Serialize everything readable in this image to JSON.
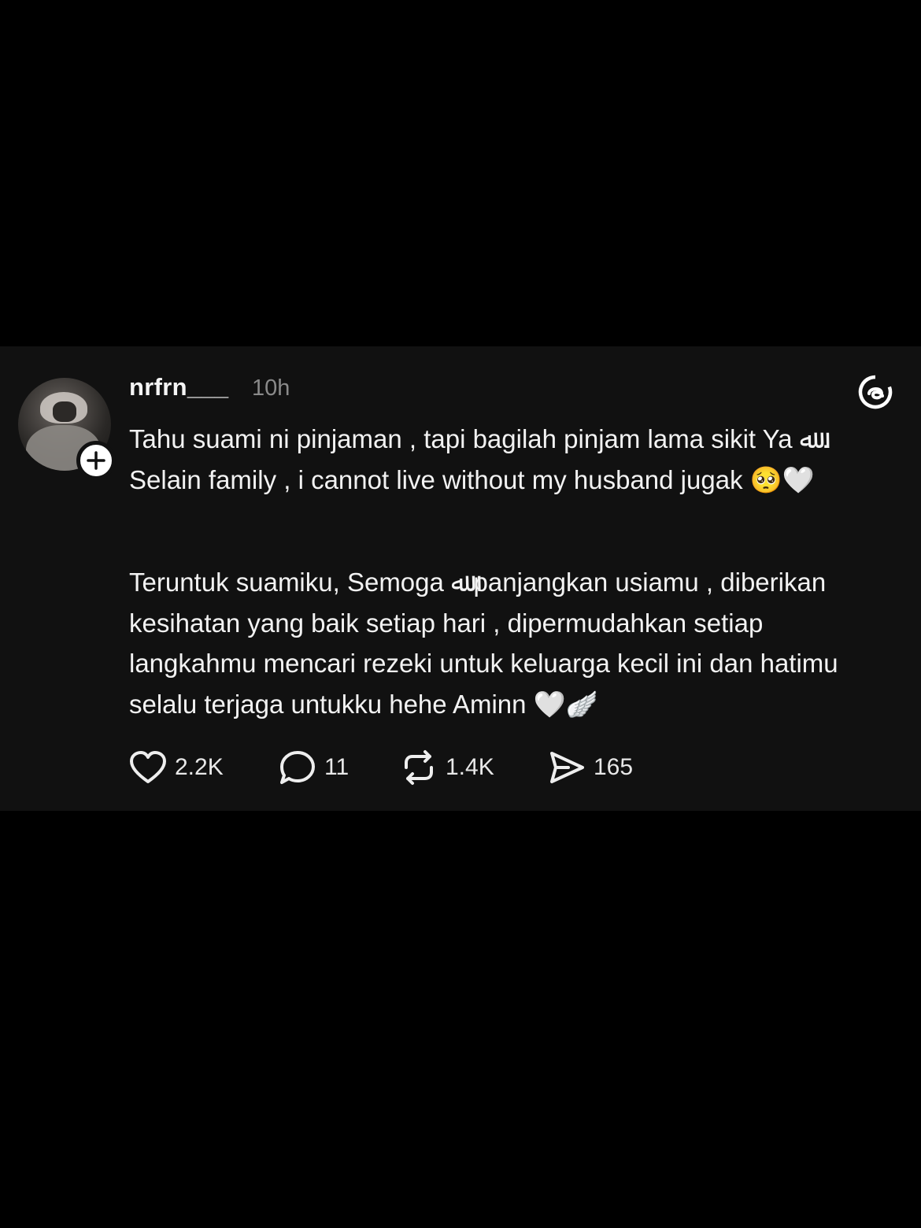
{
  "post": {
    "username": "nrfrn___",
    "timestamp": "10h",
    "paragraphs": [
      "Tahu suami ni pinjaman , tapi bagilah pinjam lama sikit Ya ﷲ . Selain family , i cannot live without my husband jugak 🥺🤍",
      "Teruntuk suamiku, Semoga ﷲ panjangkan usiamu , diberikan kesihatan yang baik setiap hari , dipermudahkan setiap langkahmu mencari rezeki untuk keluarga kecil ini dan hatimu selalu terjaga untukku hehe Aminn 🤍🪽"
    ],
    "actions": {
      "likes": "2.2K",
      "replies": "11",
      "reposts": "1.4K",
      "shares": "165"
    }
  },
  "icons": {
    "follow": "plus-icon",
    "brand": "threads-logo-icon",
    "like": "heart-icon",
    "reply": "comment-icon",
    "repost": "repost-icon",
    "share": "send-icon"
  },
  "colors": {
    "background": "#000000",
    "card": "#111111",
    "text": "#f2f2f2",
    "muted": "#8a8a8a"
  }
}
